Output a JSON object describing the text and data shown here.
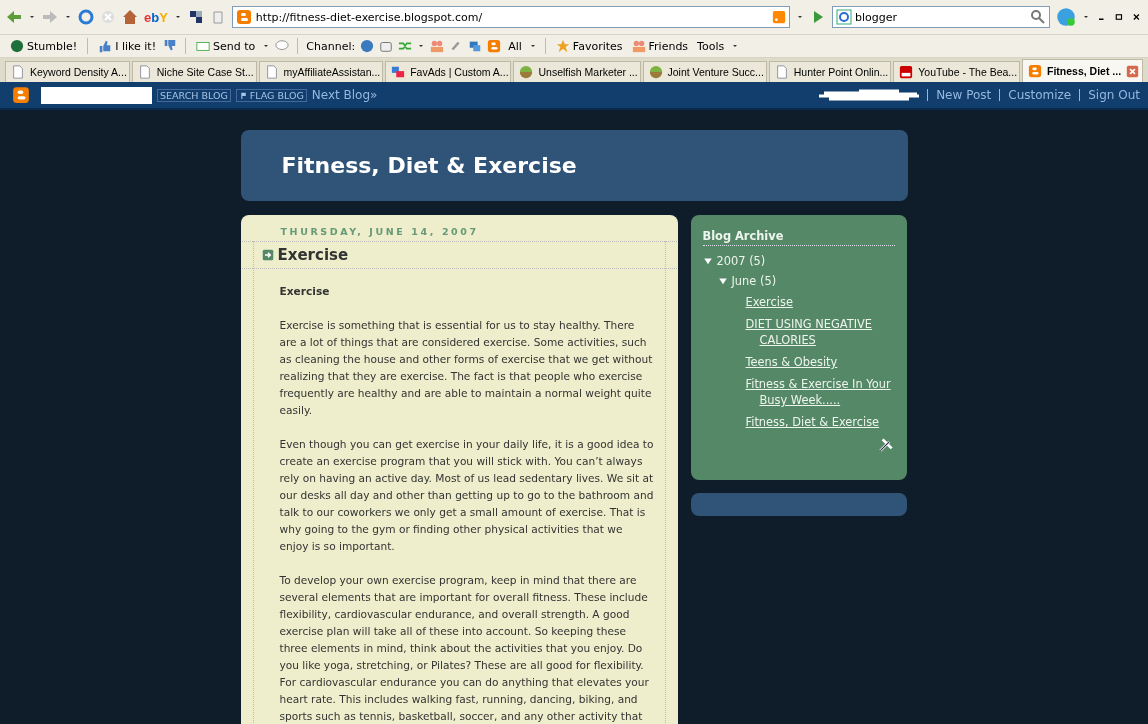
{
  "browser": {
    "address": "http://fitness-diet-exercise.blogspot.com/",
    "search": {
      "value": "blogger"
    },
    "ebay_label": "ebY",
    "links_toolbar": {
      "stumble": "Stumble!",
      "like": "I like it!",
      "send_to": "Send to",
      "channel": "Channel:",
      "all": "All",
      "favorites": "Favorites",
      "friends": "Friends",
      "tools": "Tools"
    },
    "tabs": [
      {
        "label": "Keyword Density A...",
        "kind": "page",
        "selected": false
      },
      {
        "label": "Niche Site Case St...",
        "kind": "page",
        "selected": false
      },
      {
        "label": "myAffiliateAssistan...",
        "kind": "page",
        "selected": false
      },
      {
        "label": "FavAds | Custom A...",
        "kind": "favads",
        "selected": false
      },
      {
        "label": "Unselfish Marketer ...",
        "kind": "ball",
        "selected": false
      },
      {
        "label": "Joint Venture Succ...",
        "kind": "ball",
        "selected": false
      },
      {
        "label": "Hunter Point Onlin...",
        "kind": "page",
        "selected": false
      },
      {
        "label": "YouTube - The Bea...",
        "kind": "video",
        "selected": false
      },
      {
        "label": "Fitness, Diet ...",
        "kind": "blogger",
        "selected": true
      }
    ]
  },
  "navbar": {
    "search_button": "SEARCH BLOG",
    "flag_button": "FLAG BLOG",
    "next_blog": "Next Blog»",
    "links": [
      "New Post",
      "Customize",
      "Sign Out"
    ]
  },
  "blog": {
    "title": "Fitness, Diet & Exercise",
    "post": {
      "date": "THURSDAY, JUNE 14, 2007",
      "title": "Exercise",
      "subtitle": "Exercise",
      "paragraphs": [
        "Exercise is something that is essential for us to stay healthy. There are a lot of things that are considered exercise. Some activities, such as cleaning the house and other forms of exercise that we get without realizing that they are exercise. The fact is that people who exercise frequently are healthy and are able to maintain a normal weight quite easily.",
        "Even though you can get exercise in your daily life, it is a good idea to create an exercise program that you will stick with. You can’t always rely on having an active day. Most of us lead sedentary lives. We sit at our desks all day and other than getting up to go to the bathroom and talk to our coworkers we only get a small amount of exercise. That is why going to the gym or finding other physical activities that we enjoy is so important.",
        "To develop your own exercise program, keep in mind that there are several elements that are important for overall fitness. These include flexibility, cardiovascular endurance, and overall strength. A good exercise plan will take all of these into account. So keeping these three elements in mind, think about the activities that you enjoy. Do you like yoga, stretching, or Pilates? These are all good for flexibility. For cardiovascular endurance you can do anything that elevates your heart rate. This includes walking fast, running, dancing, biking, and sports such as tennis, basketball, soccer, and any other activity that"
      ]
    },
    "archive": {
      "title": "Blog Archive",
      "tree": [
        {
          "label": "2007",
          "count": "(5)",
          "expanded": true,
          "children": [
            {
              "label": "June",
              "count": "(5)",
              "expanded": true,
              "posts": [
                "Exercise",
                "DIET USING NEGATIVE CALORIES",
                "Teens & Obesity",
                "Fitness & Exercise In Your Busy Week.....",
                "Fitness, Diet & Exercise"
              ]
            }
          ]
        }
      ]
    }
  }
}
